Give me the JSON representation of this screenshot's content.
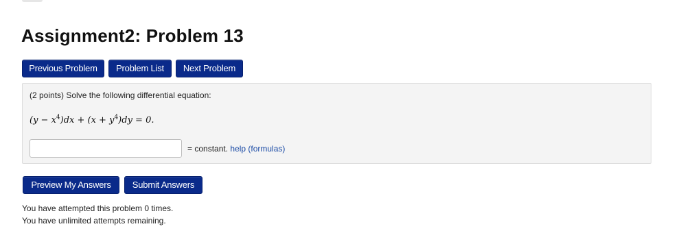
{
  "page": {
    "title": "Assignment2: Problem 13"
  },
  "nav": {
    "previous": "Previous Problem",
    "list": "Problem List",
    "next": "Next Problem"
  },
  "problem": {
    "intro": "(2 points) Solve the following differential equation:",
    "equation": {
      "part1": "(y − x",
      "exp1": "4",
      "part2": ")dx + (x + y",
      "exp2": "4",
      "part3": ")dy = 0."
    },
    "answer": {
      "value": "",
      "placeholder": ""
    },
    "suffix_text": "= constant.",
    "help_link": "help (formulas)"
  },
  "actions": {
    "preview": "Preview My Answers",
    "submit": "Submit Answers"
  },
  "status": {
    "attempts": "You have attempted this problem 0 times.",
    "remaining": "You have unlimited attempts remaining."
  },
  "colors": {
    "button_bg": "#0a2a8a",
    "link": "#1a4aa5",
    "problem_bg": "#f4f4f4"
  }
}
